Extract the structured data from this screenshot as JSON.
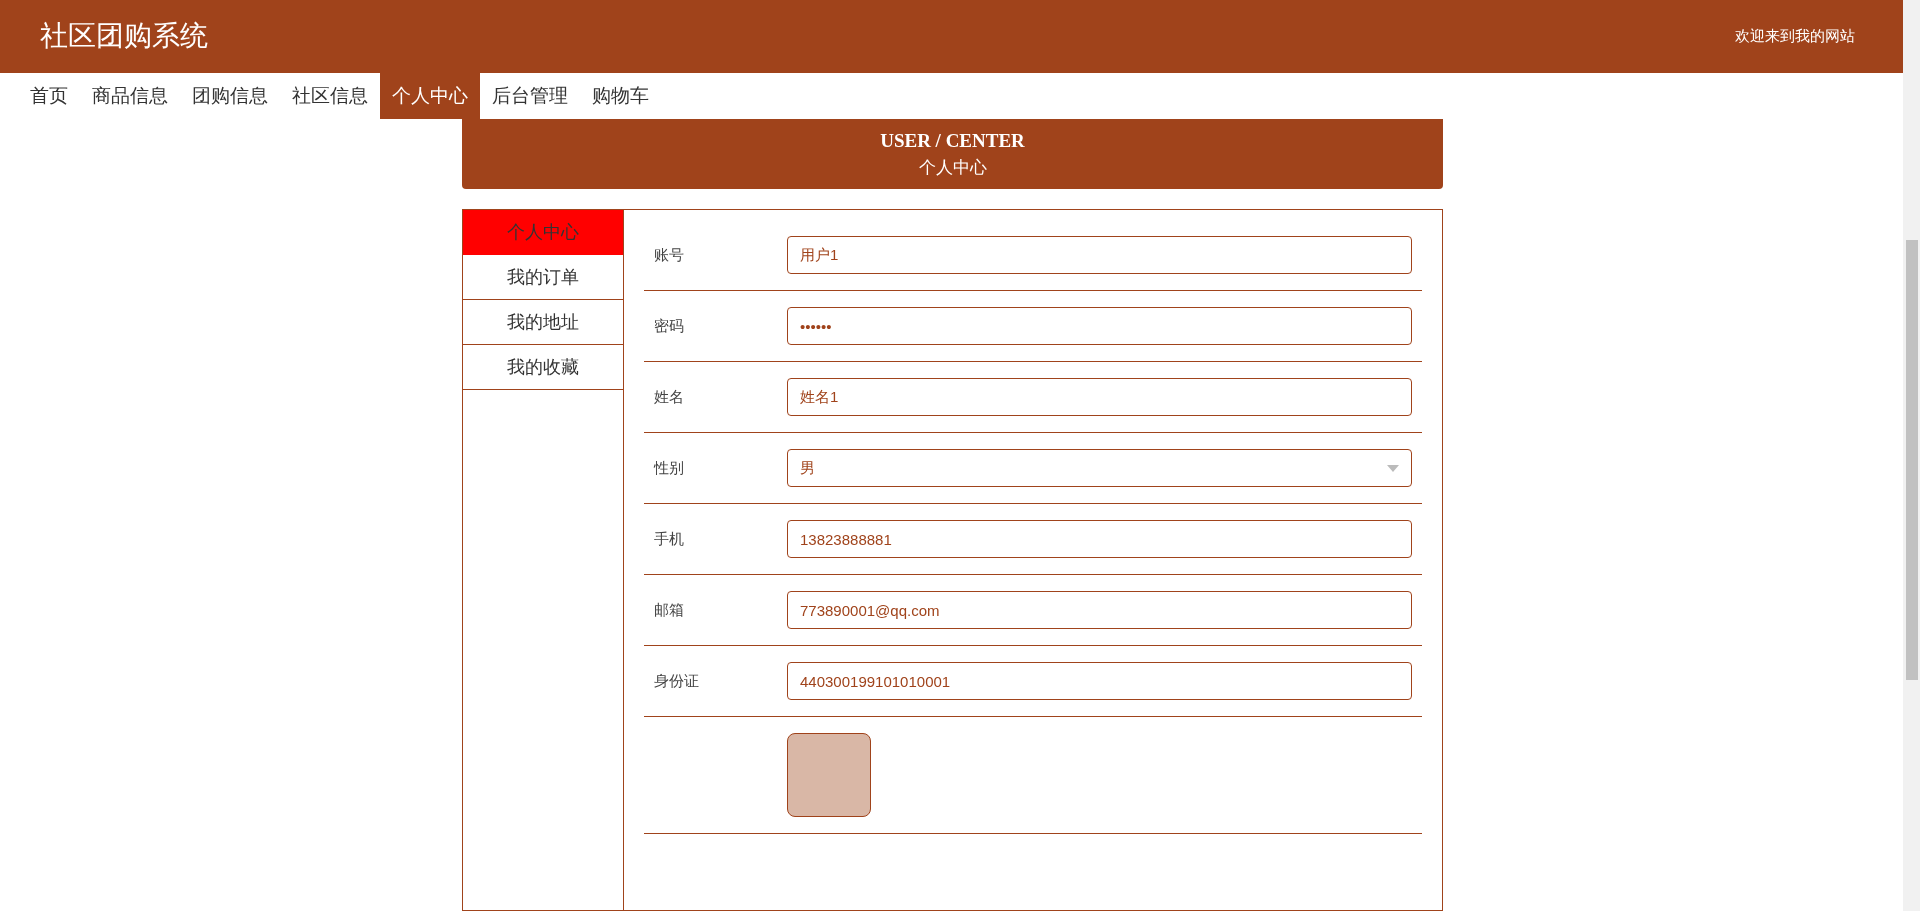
{
  "header": {
    "title": "社区团购系统",
    "welcome": "欢迎来到我的网站"
  },
  "nav": [
    {
      "label": "首页",
      "selected": false
    },
    {
      "label": "商品信息",
      "selected": false
    },
    {
      "label": "团购信息",
      "selected": false
    },
    {
      "label": "社区信息",
      "selected": false
    },
    {
      "label": "个人中心",
      "selected": true
    },
    {
      "label": "后台管理",
      "selected": false
    },
    {
      "label": "购物车",
      "selected": false
    }
  ],
  "banner": {
    "title": "USER / CENTER",
    "subtitle": "个人中心"
  },
  "sidebar": [
    {
      "label": "个人中心",
      "selected": true
    },
    {
      "label": "我的订单",
      "selected": false
    },
    {
      "label": "我的地址",
      "selected": false
    },
    {
      "label": "我的收藏",
      "selected": false
    }
  ],
  "form": [
    {
      "kind": "text",
      "label": "账号",
      "value": "用户1"
    },
    {
      "kind": "text",
      "label": "密码",
      "value": "••••••"
    },
    {
      "kind": "text",
      "label": "姓名",
      "value": "姓名1"
    },
    {
      "kind": "select",
      "label": "性别",
      "value": "男"
    },
    {
      "kind": "text",
      "label": "手机",
      "value": "13823888881"
    },
    {
      "kind": "text",
      "label": "邮箱",
      "value": "773890001@qq.com"
    },
    {
      "kind": "text",
      "label": "身份证",
      "value": "440300199101010001"
    },
    {
      "kind": "image"
    }
  ]
}
